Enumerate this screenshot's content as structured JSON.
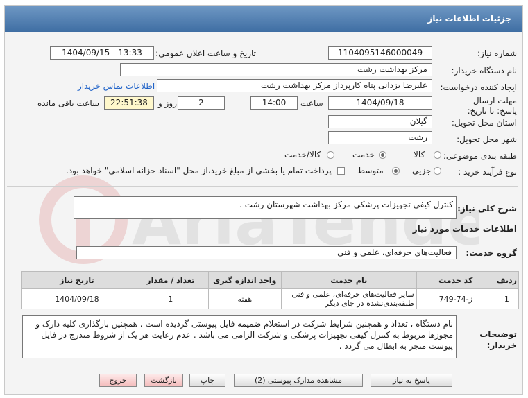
{
  "page_title": "جزئیات اطلاعات نیاز",
  "labels": {
    "need_number": "شماره نیاز:",
    "announce_datetime": "تاریخ و ساعت اعلان عمومی:",
    "buyer_org": "نام دستگاه خریدار:",
    "requester": "ایجاد کننده درخواست:",
    "deadline": "مهلت ارسال پاسخ: تا تاریخ:",
    "time_word": "ساعت",
    "day_and": "روز و",
    "remaining": "ساعت باقی مانده",
    "province": "استان محل تحویل:",
    "city": "شهر محل تحویل:",
    "category": "طبقه بندی موضوعی:",
    "process_type": "نوع فرآیند خرید :",
    "general_desc": "شرح کلی نیاز:",
    "services_info": "اطلاعات خدمات مورد نیاز",
    "service_group": "گروه خدمت:",
    "buyer_notes": "توضیحات خریدار:"
  },
  "values": {
    "need_number": "1104095146000049",
    "announce_datetime": "1404/09/15 - 13:33",
    "buyer_org": "مرکز بهداشت رشت",
    "requester": "علیرضا یزدانی پناه کارپرداز مرکز بهداشت رشت",
    "contact_link": "اطلاعات تماس خریدار",
    "deadline_date": "1404/09/18",
    "deadline_time": "14:00",
    "days": "2",
    "remaining_time": "22:51:38",
    "province": "گیلان",
    "city": "رشت",
    "general_desc": "کنترل کیفی تجهیزات پزشکی مرکز بهداشت شهرستان رشت .",
    "service_group": "فعالیت‌های حرفه‌ای، علمی و فنی",
    "buyer_notes": "نام دستگاه ، تعداد و همچنین شرایط شرکت در استعلام ضمیمه فایل پیوستی گردیده است . همچنین بارگذاری کلیه دارک و مجوزها مربوط به کنترل کیفی تجهیزات پزشکی و شرکت الزامی می باشد . عدم رعایت هر یک از شروط مندرج در فایل پیوست منجر به ابطال می گردد ."
  },
  "category_options": [
    {
      "label": "کالا",
      "selected": false
    },
    {
      "label": "خدمت",
      "selected": true
    },
    {
      "label": "کالا/خدمت",
      "selected": false
    }
  ],
  "process_options": [
    {
      "label": "جزیی",
      "selected": false
    },
    {
      "label": "متوسط",
      "selected": true
    }
  ],
  "payment_note": "پرداخت تمام یا بخشی از مبلغ خرید،از محل \"اسناد خزانه اسلامی\" خواهد بود.",
  "table": {
    "headers": [
      "ردیف",
      "کد خدمت",
      "نام خدمت",
      "واحد اندازه گیری",
      "تعداد / مقدار",
      "تاریخ نیاز"
    ],
    "rows": [
      [
        "1",
        "ز-74-749",
        "سایر فعالیت‌های حرفه‌ای، علمی و فنی طبقه‌بندی‌نشده در جای دیگر",
        "هفته",
        "1",
        "1404/09/18"
      ]
    ]
  },
  "buttons": {
    "reply": "پاسخ به نیاز",
    "attachments": "مشاهده مدارک پیوستی (2)",
    "print": "چاپ",
    "back": "بازگشت",
    "exit": "خروج"
  },
  "watermark": "AriaTender.net",
  "colors": {
    "title_bar": "#4f7fb3",
    "link": "#1f62c8",
    "remaining_bg": "#fff8cc",
    "exit_btn": "#f4bcbc"
  }
}
